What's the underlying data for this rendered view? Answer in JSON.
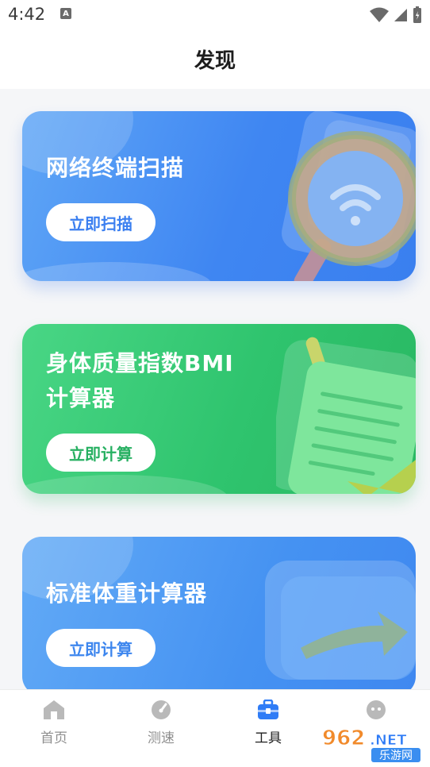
{
  "status_bar": {
    "time": "4:42",
    "notification_icon": "A",
    "icons": [
      "wifi-icon",
      "signal-icon",
      "battery-icon"
    ]
  },
  "header": {
    "title": "发现"
  },
  "cards": [
    {
      "title_line1": "网络终端扫描",
      "title_line2": "",
      "button": "立即扫描",
      "accent": "#3f86f2",
      "button_text_color": "#3b7ff0",
      "icon": "magnifier-wifi-icon"
    },
    {
      "title_line1": "身体质量指数BMI",
      "title_line2": "计算器",
      "button": "立即计算",
      "accent": "#2fc46e",
      "button_text_color": "#27b062",
      "icon": "document-check-icon"
    },
    {
      "title_line1": "标准体重计算器",
      "title_line2": "",
      "button": "立即计算",
      "accent": "#4592f2",
      "button_text_color": "#3d86ee",
      "icon": "box-arrow-icon"
    }
  ],
  "bottom_nav": [
    {
      "label": "首页",
      "icon": "home-icon",
      "active": false
    },
    {
      "label": "测速",
      "icon": "speedometer-icon",
      "active": false
    },
    {
      "label": "工具",
      "icon": "toolbox-icon",
      "active": true
    },
    {
      "label": "",
      "icon": "chat-icon",
      "active": false
    }
  ],
  "watermark": {
    "text": "962.NET",
    "subtext": "乐游网"
  },
  "colors": {
    "nav_active": "#2f7cf6",
    "nav_inactive": "#b9b9b9"
  }
}
